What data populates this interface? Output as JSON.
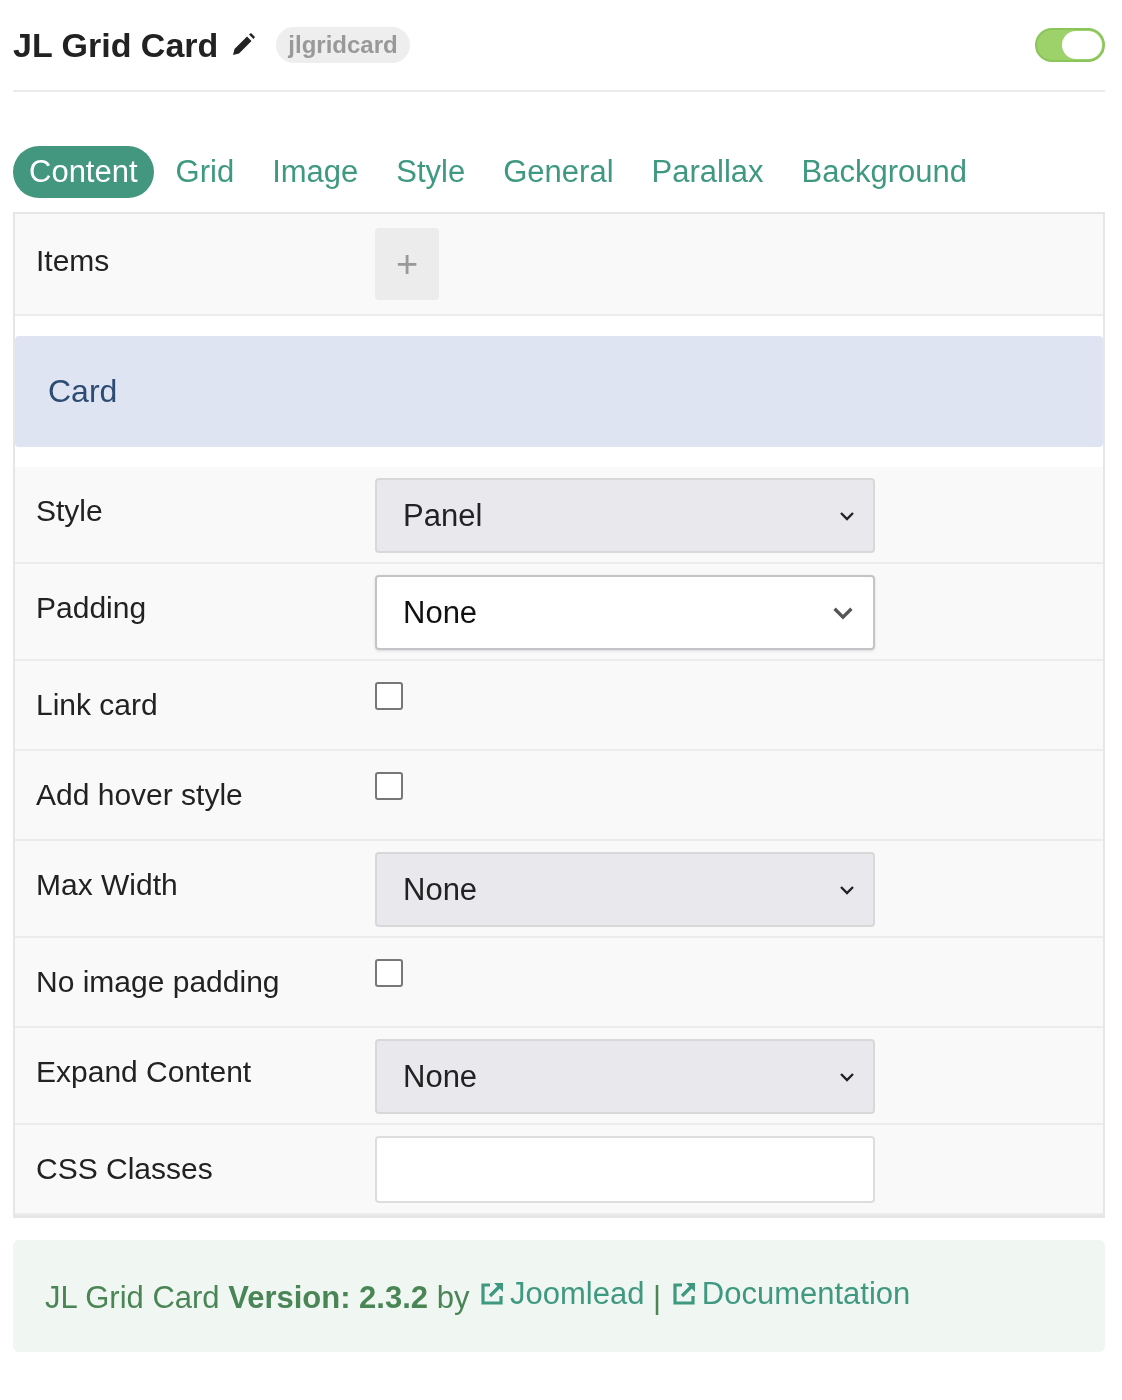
{
  "header": {
    "title": "JL Grid Card",
    "alias": "jlgridcard",
    "enabled": true
  },
  "tabs": [
    {
      "label": "Content",
      "selected": true
    },
    {
      "label": "Grid",
      "selected": false
    },
    {
      "label": "Image",
      "selected": false
    },
    {
      "label": "Style",
      "selected": false
    },
    {
      "label": "General",
      "selected": false
    },
    {
      "label": "Parallax",
      "selected": false
    },
    {
      "label": "Background",
      "selected": false
    }
  ],
  "fields": [
    {
      "kind": "add",
      "label": "Items",
      "button": "+"
    },
    {
      "kind": "section",
      "label": "Card"
    },
    {
      "kind": "select",
      "label": "Style",
      "value": "Panel",
      "focused": false
    },
    {
      "kind": "select",
      "label": "Padding",
      "value": "None",
      "focused": true
    },
    {
      "kind": "checkbox",
      "label": "Link card",
      "checked": false
    },
    {
      "kind": "checkbox",
      "label": "Add hover style",
      "checked": false
    },
    {
      "kind": "select",
      "label": "Max Width",
      "value": "None",
      "focused": false
    },
    {
      "kind": "checkbox",
      "label": "No image padding",
      "checked": false
    },
    {
      "kind": "select",
      "label": "Expand Content",
      "value": "None",
      "focused": false
    },
    {
      "kind": "text",
      "label": "CSS Classes"
    }
  ],
  "footer": {
    "text": "JL Grid Card **Version: 2.3.2** by",
    "links": [
      "Joomlead",
      "Documentation"
    ],
    "separator": "|"
  }
}
